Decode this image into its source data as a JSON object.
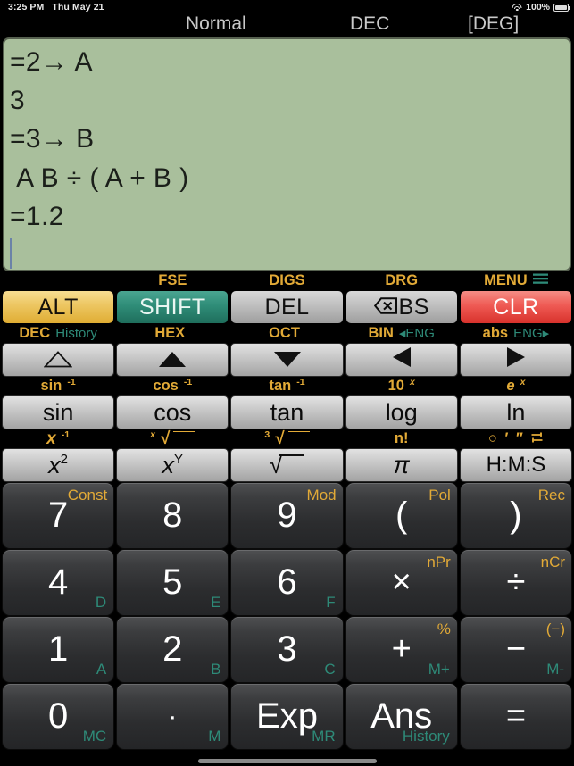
{
  "status_bar": {
    "time": "3:25 PM",
    "date": "Thu May 21",
    "battery_percent": "100%",
    "wifi_icon": "wifi-icon",
    "battery_icon": "battery-icon"
  },
  "mode_header": {
    "display_mode": "Normal",
    "number_base": "DEC",
    "angle_unit": "[DEG]"
  },
  "display": {
    "background_color": "#a9bf9c",
    "lines": [
      "=2→ A",
      "3",
      "=3→ B",
      " A B ÷ ( A + B )",
      "=1.2"
    ],
    "caret": "text-cursor"
  },
  "function_row": {
    "shift_labels": [
      "",
      "FSE",
      "DIGS",
      "DRG",
      "MENU"
    ],
    "menu_icon": "hamburger-menu-icon",
    "keys": [
      {
        "label": "ALT",
        "name": "alt-key",
        "color": "#edc763"
      },
      {
        "label": "SHIFT",
        "name": "shift-key",
        "color": "#2f8d78"
      },
      {
        "label": "DEL",
        "name": "del-key",
        "color": "#bdbdbd"
      },
      {
        "label": "BS",
        "name": "backspace-key",
        "icon": "backspace-icon",
        "color": "#bdbdbd"
      },
      {
        "label": "CLR",
        "name": "clear-key",
        "color": "#ef5a54"
      }
    ]
  },
  "arrow_row": {
    "labels": [
      {
        "gold": "DEC",
        "teal": "History"
      },
      {
        "gold": "HEX",
        "teal": ""
      },
      {
        "gold": "OCT",
        "teal": ""
      },
      {
        "gold": "BIN",
        "teal": "◂ENG"
      },
      {
        "gold": "abs",
        "teal": "ENG▸"
      }
    ],
    "keys": [
      {
        "icon": "triangle-up-outline-icon",
        "name": "cursor-up-outline-key"
      },
      {
        "icon": "triangle-up-filled-icon",
        "name": "cursor-up-key"
      },
      {
        "icon": "triangle-down-filled-icon",
        "name": "cursor-down-key"
      },
      {
        "icon": "triangle-left-filled-icon",
        "name": "cursor-left-key"
      },
      {
        "icon": "triangle-right-filled-icon",
        "name": "cursor-right-key"
      }
    ]
  },
  "trig_row": {
    "shift_labels": [
      "sin",
      "cos",
      "tan",
      "10",
      "e"
    ],
    "shift_sups": [
      "-1",
      "-1",
      "-1",
      "x",
      "x"
    ],
    "keys": [
      {
        "label": "sin",
        "name": "sin-key"
      },
      {
        "label": "cos",
        "name": "cos-key"
      },
      {
        "label": "tan",
        "name": "tan-key"
      },
      {
        "label": "log",
        "name": "log-key"
      },
      {
        "label": "ln",
        "name": "ln-key"
      }
    ]
  },
  "power_row": {
    "shift_labels": [
      "x",
      "√",
      "√",
      "n!",
      "○ ′ ″"
    ],
    "shift_sups": [
      "-1",
      "x",
      "3",
      "",
      ""
    ],
    "keys": [
      {
        "label": "x",
        "sup": "2",
        "name": "square-key"
      },
      {
        "label": "x",
        "sup": "Y",
        "name": "power-key"
      },
      {
        "label": "√",
        "sup": "",
        "name": "sqrt-key"
      },
      {
        "label": "π",
        "sup": "",
        "name": "pi-key"
      },
      {
        "label": "H:M:S",
        "sup": "",
        "name": "hms-key"
      }
    ]
  },
  "keypad_rows": [
    [
      {
        "label": "7",
        "name": "digit-7-key",
        "alt": "Const",
        "hex": ""
      },
      {
        "label": "8",
        "name": "digit-8-key",
        "alt": "",
        "hex": ""
      },
      {
        "label": "9",
        "name": "digit-9-key",
        "alt": "Mod",
        "hex": ""
      },
      {
        "label": "(",
        "name": "left-paren-key",
        "alt": "Pol",
        "hex": ""
      },
      {
        "label": ")",
        "name": "right-paren-key",
        "alt": "Rec",
        "hex": ""
      }
    ],
    [
      {
        "label": "4",
        "name": "digit-4-key",
        "alt": "",
        "hex": "D"
      },
      {
        "label": "5",
        "name": "digit-5-key",
        "alt": "",
        "hex": "E"
      },
      {
        "label": "6",
        "name": "digit-6-key",
        "alt": "",
        "hex": "F"
      },
      {
        "label": "×",
        "name": "multiply-key",
        "alt": "nPr",
        "hex": ""
      },
      {
        "label": "÷",
        "name": "divide-key",
        "alt": "nCr",
        "hex": ""
      }
    ],
    [
      {
        "label": "1",
        "name": "digit-1-key",
        "alt": "",
        "hex": "A"
      },
      {
        "label": "2",
        "name": "digit-2-key",
        "alt": "",
        "hex": "B"
      },
      {
        "label": "3",
        "name": "digit-3-key",
        "alt": "",
        "hex": "C"
      },
      {
        "label": "+",
        "name": "plus-key",
        "alt": "%",
        "hex": "M+"
      },
      {
        "label": "−",
        "name": "minus-key",
        "alt": "(−)",
        "hex": "M-"
      }
    ],
    [
      {
        "label": "0",
        "name": "digit-0-key",
        "alt": "",
        "hex": "MC"
      },
      {
        "label": "·",
        "name": "decimal-point-key",
        "alt": "",
        "hex": "M"
      },
      {
        "label": "Exp",
        "name": "exponent-key",
        "alt": "",
        "hex": "MR"
      },
      {
        "label": "Ans",
        "name": "answer-key",
        "alt": "",
        "hex": "History"
      },
      {
        "label": "=",
        "name": "equals-key",
        "alt": "",
        "hex": ""
      }
    ]
  ],
  "colors": {
    "gold": "#e2aa37",
    "teal": "#2e8a78",
    "red": "#ef5a54",
    "display_bg": "#a9bf9c"
  }
}
